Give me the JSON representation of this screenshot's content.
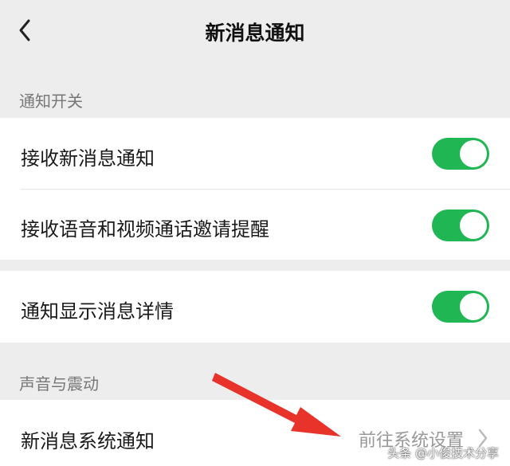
{
  "nav": {
    "title": "新消息通知"
  },
  "sections": {
    "notify_switch": "通知开关",
    "sound_vibration": "声音与震动"
  },
  "rows": {
    "receive_new": {
      "label": "接收新消息通知",
      "enabled": true
    },
    "receive_call": {
      "label": "接收语音和视频通话邀请提醒",
      "enabled": true
    },
    "show_details": {
      "label": "通知显示消息详情",
      "enabled": true
    },
    "system_notify": {
      "label": "新消息系统通知",
      "action": "前往系统设置"
    }
  },
  "watermark": "头条 @小俊技术分享",
  "colors": {
    "toggle_on": "#1fb653",
    "arrow": "#e8332b",
    "background": "#ededed"
  }
}
